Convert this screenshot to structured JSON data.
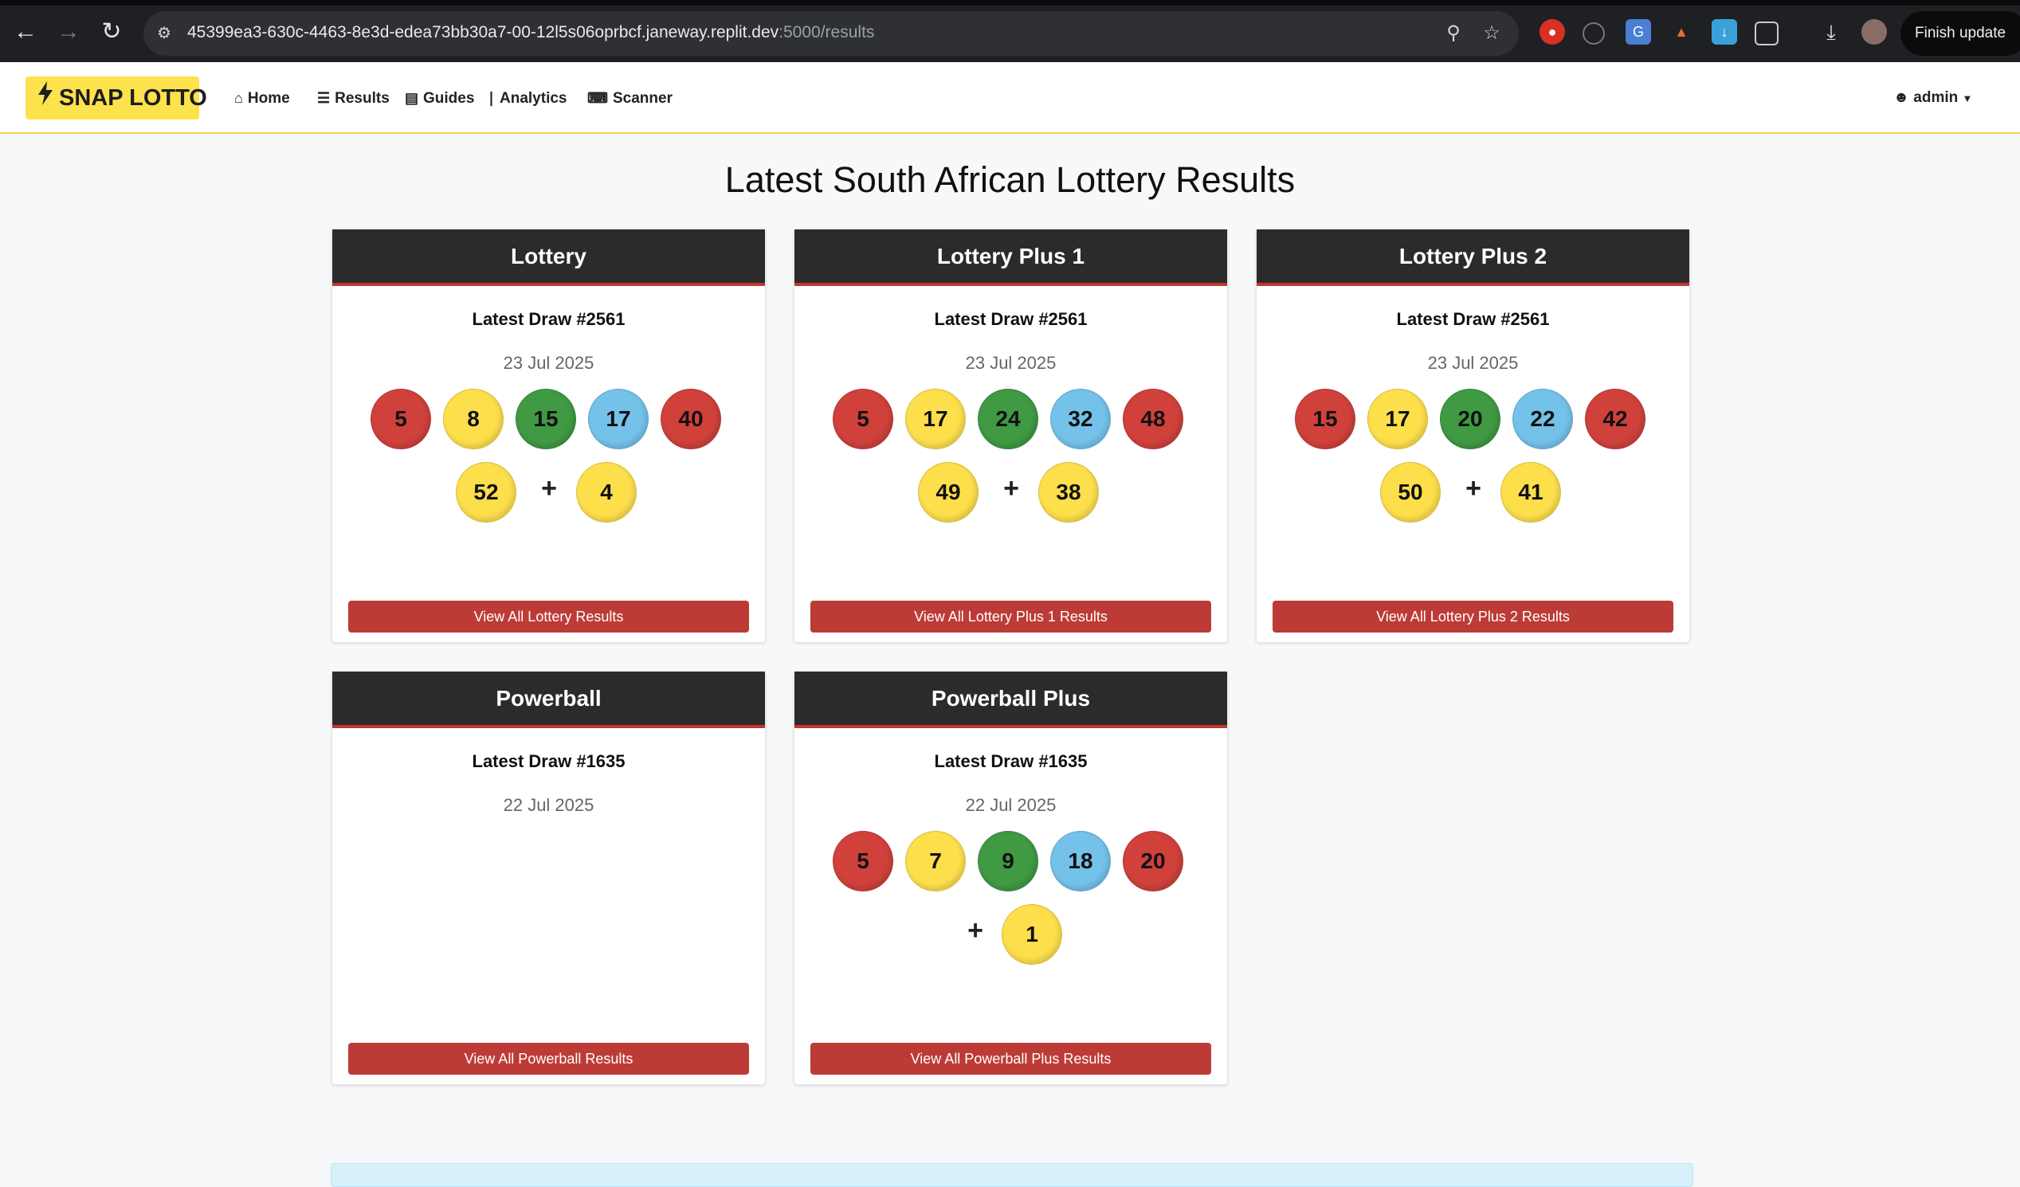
{
  "browser": {
    "url_host": "45399ea3-630c-4463-8e3d-edea73bb30a7-00-12l5s06oprbcf.janeway.replit.dev",
    "url_path": ":5000/results",
    "finish_update_label": "Finish update",
    "icons": {
      "back": "arrow-left-icon",
      "forward": "arrow-right-icon",
      "reload": "reload-icon",
      "zoom": "zoom-icon",
      "bookmark": "star-icon",
      "download": "download-icon"
    }
  },
  "navbar": {
    "brand_label": "SNAP LOTTO",
    "links": [
      {
        "label": "Home",
        "icon": "home-icon"
      },
      {
        "label": "Results",
        "icon": "list-icon"
      },
      {
        "label": "Guides",
        "icon": "book-icon"
      },
      {
        "label": "Analytics",
        "icon": "chart-icon"
      },
      {
        "label": "Scanner",
        "icon": "keyboard-icon"
      }
    ],
    "user_label": "admin",
    "colors": {
      "brand_bg": "#fce24c",
      "underline": "#f2d25a"
    }
  },
  "page": {
    "title": "Latest South African Lottery Results",
    "colors": {
      "header_bg": "#2b2b2b",
      "accent": "#c4342f",
      "button": "#bd3b36"
    }
  },
  "games": [
    {
      "name": "Lottery",
      "draw_label": "Latest Draw #2561",
      "date": "23 Jul 2025",
      "balls": [
        "5",
        "8",
        "15",
        "17",
        "40",
        "52"
      ],
      "ball_colors": [
        "red",
        "yellow",
        "green",
        "blue",
        "red",
        "yellow"
      ],
      "plus": "+",
      "bonus": "4",
      "bonus_color": "yellow",
      "button_label": "View All Lottery Results"
    },
    {
      "name": "Lottery Plus 1",
      "draw_label": "Latest Draw #2561",
      "date": "23 Jul 2025",
      "balls": [
        "5",
        "17",
        "24",
        "32",
        "48",
        "49"
      ],
      "ball_colors": [
        "red",
        "yellow",
        "green",
        "blue",
        "red",
        "yellow"
      ],
      "plus": "+",
      "bonus": "38",
      "bonus_color": "yellow",
      "button_label": "View All Lottery Plus 1 Results"
    },
    {
      "name": "Lottery Plus 2",
      "draw_label": "Latest Draw #2561",
      "date": "23 Jul 2025",
      "balls": [
        "15",
        "17",
        "20",
        "22",
        "42",
        "50"
      ],
      "ball_colors": [
        "red",
        "yellow",
        "green",
        "blue",
        "red",
        "yellow"
      ],
      "plus": "+",
      "bonus": "41",
      "bonus_color": "yellow",
      "button_label": "View All Lottery Plus 2 Results"
    },
    {
      "name": "Powerball",
      "draw_label": "Latest Draw #1635",
      "date": "22 Jul 2025",
      "balls": [],
      "button_label": "View All Powerball Results"
    },
    {
      "name": "Powerball Plus",
      "draw_label": "Latest Draw #1635",
      "date": "22 Jul 2025",
      "balls": [
        "5",
        "7",
        "9",
        "18",
        "20"
      ],
      "ball_colors": [
        "red",
        "yellow",
        "green",
        "blue",
        "red"
      ],
      "plus": "+",
      "bonus": "1",
      "bonus_color": "yellow",
      "button_label": "View All Powerball Plus Results"
    }
  ]
}
